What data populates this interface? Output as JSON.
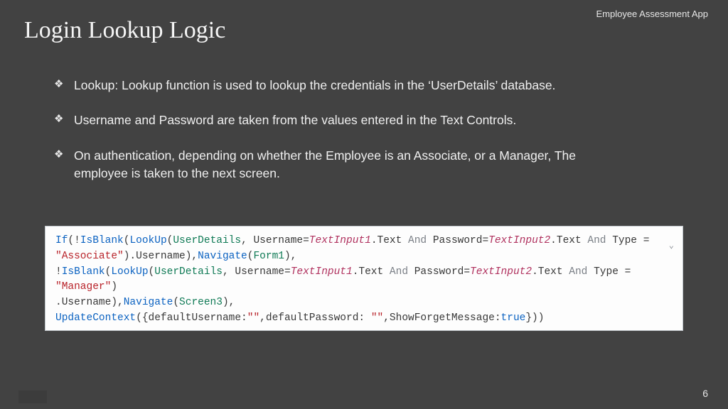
{
  "header": {
    "app_name": "Employee Assessment App"
  },
  "title": "Login Lookup Logic",
  "bullets": [
    "Lookup: Lookup function is used to lookup the credentials in the ‘UserDetails’ database.",
    "Username and Password are taken from the values entered in the Text Controls.",
    "On authentication, depending on whether the Employee is an Associate, or a Manager, The employee is taken to the next screen."
  ],
  "code": {
    "tokens": [
      [
        [
          "kw",
          "If"
        ],
        [
          "",
          "(!"
        ],
        [
          "kw",
          "IsBlank"
        ],
        [
          "",
          "("
        ],
        [
          "kw",
          "LookUp"
        ],
        [
          "",
          "("
        ],
        [
          "ident",
          "UserDetails"
        ],
        [
          "",
          ", Username="
        ],
        [
          "var",
          "TextInput1"
        ],
        [
          "",
          ".Text "
        ],
        [
          "op",
          "And"
        ],
        [
          "",
          " Password="
        ],
        [
          "var",
          "TextInput2"
        ],
        [
          "",
          ".Text "
        ],
        [
          "op",
          "And"
        ],
        [
          "",
          " Type = "
        ]
      ],
      [
        [
          "str",
          "\"Associate\""
        ],
        [
          "",
          ").Username),"
        ],
        [
          "kw",
          "Navigate"
        ],
        [
          "",
          "("
        ],
        [
          "ident",
          "Form1"
        ],
        [
          "",
          "),"
        ]
      ],
      [
        [
          "",
          "!"
        ],
        [
          "kw",
          "IsBlank"
        ],
        [
          "",
          "("
        ],
        [
          "kw",
          "LookUp"
        ],
        [
          "",
          "("
        ],
        [
          "ident",
          "UserDetails"
        ],
        [
          "",
          ", Username="
        ],
        [
          "var",
          "TextInput1"
        ],
        [
          "",
          ".Text "
        ],
        [
          "op",
          "And"
        ],
        [
          "",
          " Password="
        ],
        [
          "var",
          "TextInput2"
        ],
        [
          "",
          ".Text "
        ],
        [
          "op",
          "And"
        ],
        [
          "",
          " Type = "
        ],
        [
          "str",
          "\"Manager\""
        ],
        [
          "",
          ")"
        ]
      ],
      [
        [
          "",
          ".Username),"
        ],
        [
          "kw",
          "Navigate"
        ],
        [
          "",
          "("
        ],
        [
          "ident",
          "Screen3"
        ],
        [
          "",
          "),"
        ]
      ],
      [
        [
          "kw",
          "UpdateContext"
        ],
        [
          "",
          "({defaultUsername:"
        ],
        [
          "str",
          "\"\""
        ],
        [
          "",
          ",defaultPassword: "
        ],
        [
          "str",
          "\"\""
        ],
        [
          "",
          ",ShowForgetMessage:"
        ],
        [
          "bool",
          "true"
        ],
        [
          "",
          "}))"
        ]
      ]
    ]
  },
  "page_number": "6",
  "chevron": "⌄"
}
